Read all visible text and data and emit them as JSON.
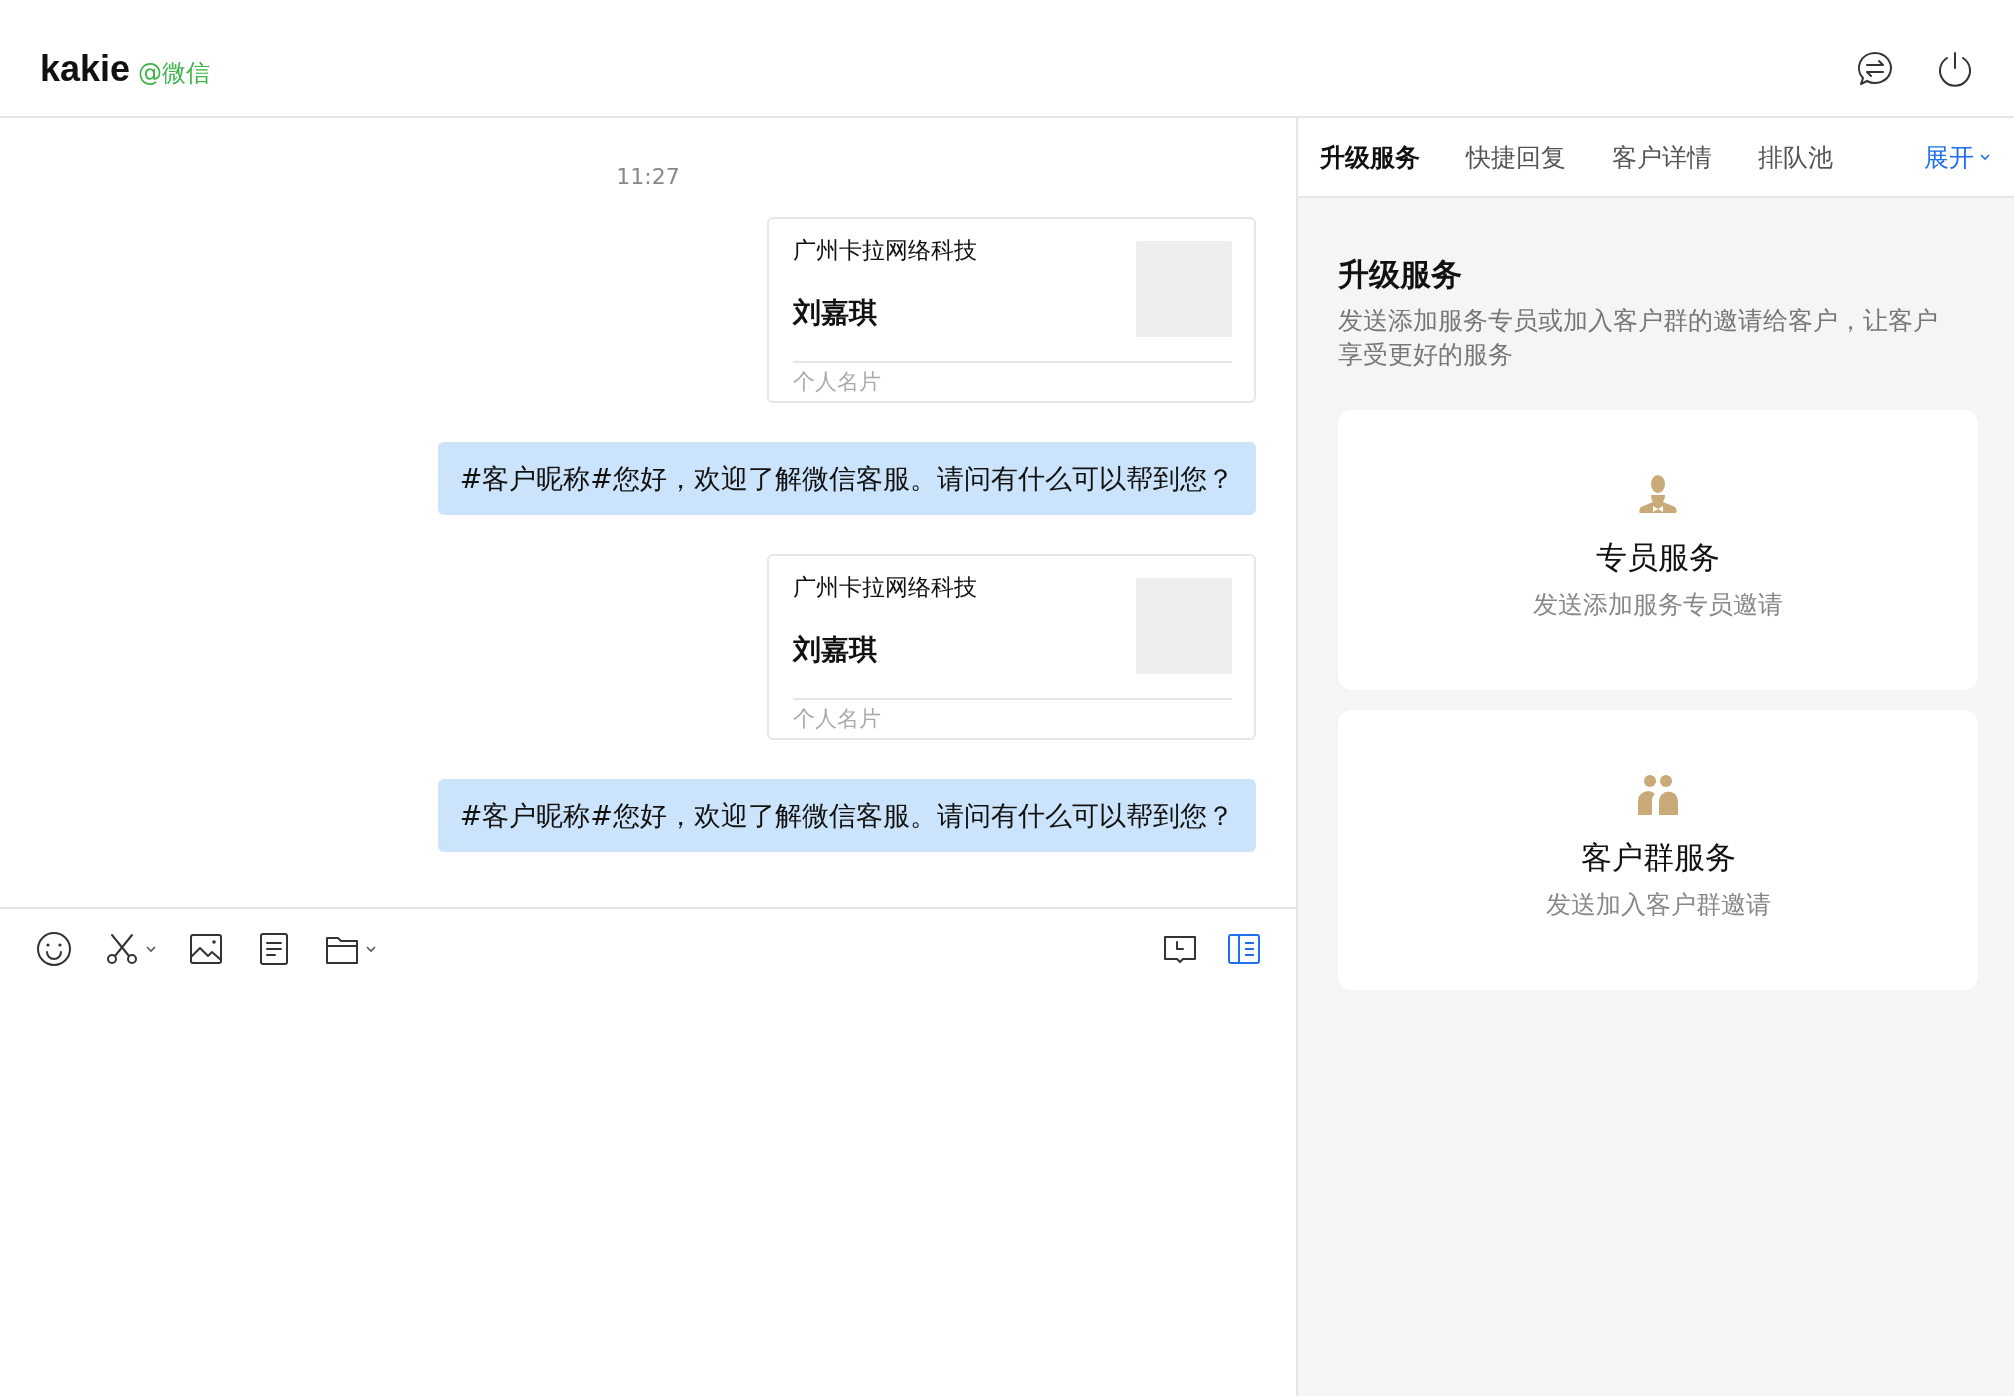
{
  "header": {
    "name": "kakie",
    "account": "@微信",
    "icons": [
      {
        "kind": "switch-chat"
      },
      {
        "kind": "power"
      }
    ]
  },
  "chat": {
    "time": "11:27",
    "messages": [
      {
        "kind": "card",
        "company": "广州卡拉网络科技",
        "name": "刘嘉琪",
        "label": "个人名片"
      },
      {
        "kind": "text",
        "text": "#客户昵称#您好，欢迎了解微信客服。请问有什么可以帮到您？"
      },
      {
        "kind": "card",
        "company": "广州卡拉网络科技",
        "name": "刘嘉琪",
        "label": "个人名片"
      },
      {
        "kind": "text",
        "text": "#客户昵称#您好，欢迎了解微信客服。请问有什么可以帮到您？"
      }
    ]
  },
  "toolbar": {
    "left": [
      {
        "kind": "emoji",
        "menu": false
      },
      {
        "kind": "scissors",
        "menu": true
      },
      {
        "kind": "image",
        "menu": false
      },
      {
        "kind": "note",
        "menu": false
      },
      {
        "kind": "folder",
        "menu": true
      }
    ],
    "right": [
      {
        "kind": "history",
        "selected": false
      },
      {
        "kind": "panel",
        "selected": true
      }
    ]
  },
  "side": {
    "tabs": [
      {
        "label": "升级服务",
        "selected": true
      },
      {
        "label": "快捷回复",
        "selected": false
      },
      {
        "label": "客户详情",
        "selected": false
      },
      {
        "label": "排队池",
        "selected": false
      }
    ],
    "expand": "展开",
    "title": "升级服务",
    "description": "发送添加服务专员或加入客户群的邀请给客户，让客户享受更好的服务",
    "options": [
      {
        "kind": "staff",
        "title": "专员服务",
        "subtitle": "发送添加服务专员邀请"
      },
      {
        "kind": "group",
        "title": "客户群服务",
        "subtitle": "发送加入客户群邀请"
      }
    ]
  }
}
